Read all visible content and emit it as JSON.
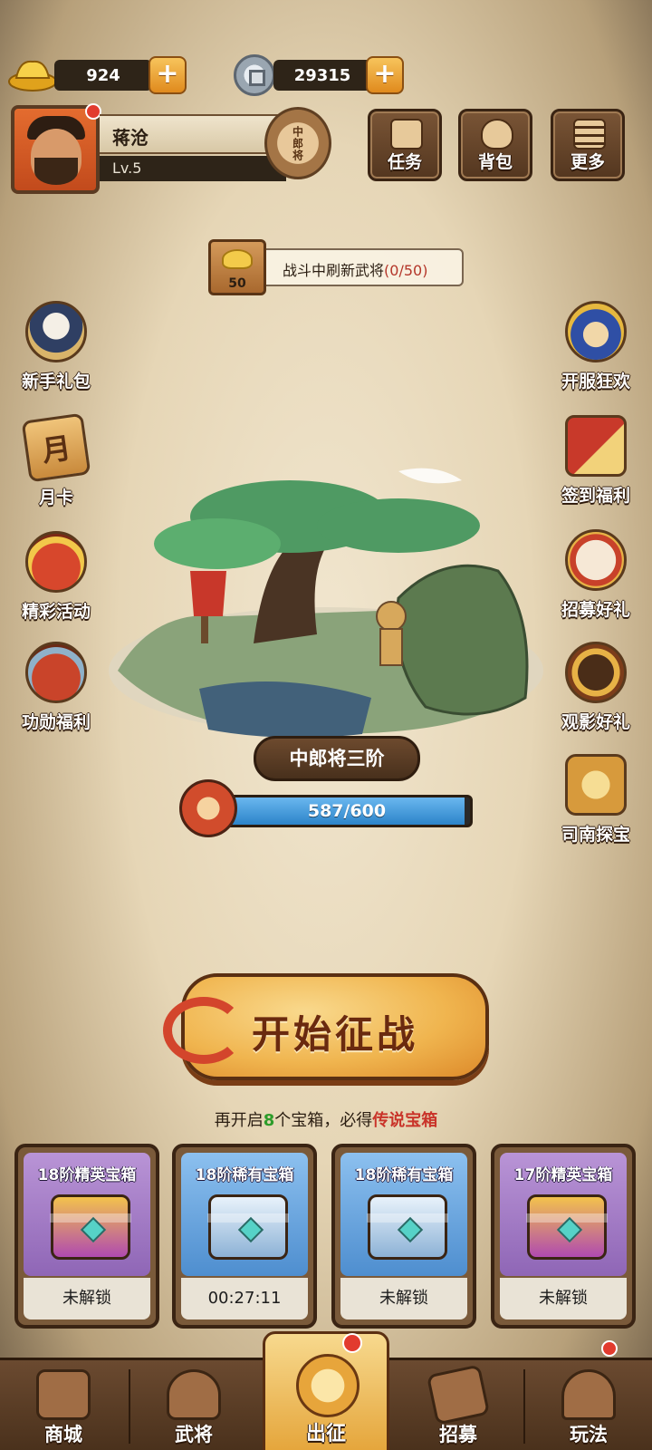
{
  "currency": {
    "ingot": {
      "icon": "gold-ingot-icon",
      "value": "924"
    },
    "coin": {
      "icon": "copper-coin-icon",
      "value": "29315"
    }
  },
  "player": {
    "name": "蒋沧",
    "level": "Lv.5",
    "rank_badge": "中郎将"
  },
  "top_menu": [
    {
      "label": "任务",
      "icon": "scroll-icon"
    },
    {
      "label": "背包",
      "icon": "bag-icon"
    },
    {
      "label": "更多",
      "icon": "list-icon"
    }
  ],
  "refresh": {
    "cost": "50",
    "text": "战斗中刷新武将",
    "progress": "(0/50)"
  },
  "left_side": [
    {
      "label": "新手礼包",
      "icon": "newbie-gift-icon"
    },
    {
      "label": "月卡",
      "icon": "month-card-icon",
      "glyph": "月"
    },
    {
      "label": "精彩活动",
      "icon": "event-bag-icon"
    },
    {
      "label": "功勋福利",
      "icon": "merit-bag-icon"
    }
  ],
  "right_side": [
    {
      "label": "开服狂欢",
      "icon": "server-carnival-icon"
    },
    {
      "label": "签到福利",
      "icon": "signin-icon"
    },
    {
      "label": "招募好礼",
      "icon": "recruit-drum-icon"
    },
    {
      "label": "观影好礼",
      "icon": "video-gift-icon"
    },
    {
      "label": "司南探宝",
      "icon": "compass-treasure-icon"
    }
  ],
  "stage": {
    "rank_title": "中郎将三阶",
    "xp_text": "587/600",
    "xp_current": 587,
    "xp_max": 600
  },
  "battle": {
    "label": "开始征战"
  },
  "hint": {
    "prefix": "再开启",
    "count": "8",
    "middle": "个宝箱，必得",
    "reward": "传说宝箱"
  },
  "chests": [
    {
      "title": "18阶精英宝箱",
      "status": "未解锁",
      "kind": "purple"
    },
    {
      "title": "18阶稀有宝箱",
      "status": "00:27:11",
      "kind": "blue"
    },
    {
      "title": "18阶稀有宝箱",
      "status": "未解锁",
      "kind": "blue"
    },
    {
      "title": "17阶精英宝箱",
      "status": "未解锁",
      "kind": "purple"
    }
  ],
  "nav": [
    {
      "label": "商城",
      "icon": "shop-icon"
    },
    {
      "label": "武将",
      "icon": "general-helmet-icon"
    },
    {
      "label": "出征",
      "icon": "expedition-icon",
      "active": true
    },
    {
      "label": "招募",
      "icon": "recruit-scroll-icon"
    },
    {
      "label": "玩法",
      "icon": "pavilion-icon"
    }
  ]
}
